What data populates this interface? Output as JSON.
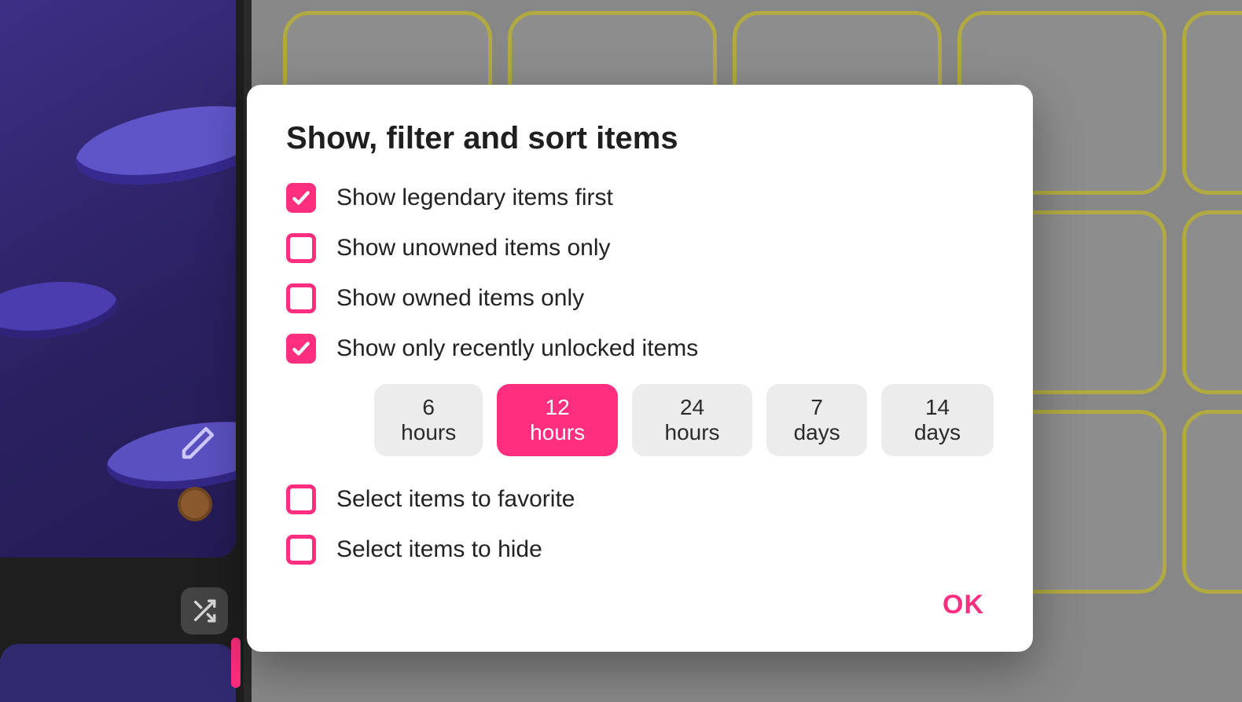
{
  "modal": {
    "title": "Show, filter and sort items",
    "options": [
      {
        "key": "legendary-first",
        "label": "Show legendary items first",
        "checked": true
      },
      {
        "key": "unowned-only",
        "label": "Show unowned items only",
        "checked": false
      },
      {
        "key": "owned-only",
        "label": "Show owned items only",
        "checked": false
      },
      {
        "key": "recently-unlocked",
        "label": "Show only recently unlocked items",
        "checked": true
      },
      {
        "key": "favorite",
        "label": "Select items to favorite",
        "checked": false
      },
      {
        "key": "hide",
        "label": "Select items to hide",
        "checked": false
      }
    ],
    "time_ranges": [
      {
        "label": "6 hours",
        "active": false
      },
      {
        "label": "12 hours",
        "active": true
      },
      {
        "label": "24 hours",
        "active": false
      },
      {
        "label": "7 days",
        "active": false
      },
      {
        "label": "14 days",
        "active": false
      }
    ],
    "ok_label": "OK"
  },
  "sidebar": {
    "edit_icon": "pencil-icon",
    "shuffle_icon": "shuffle-icon"
  }
}
